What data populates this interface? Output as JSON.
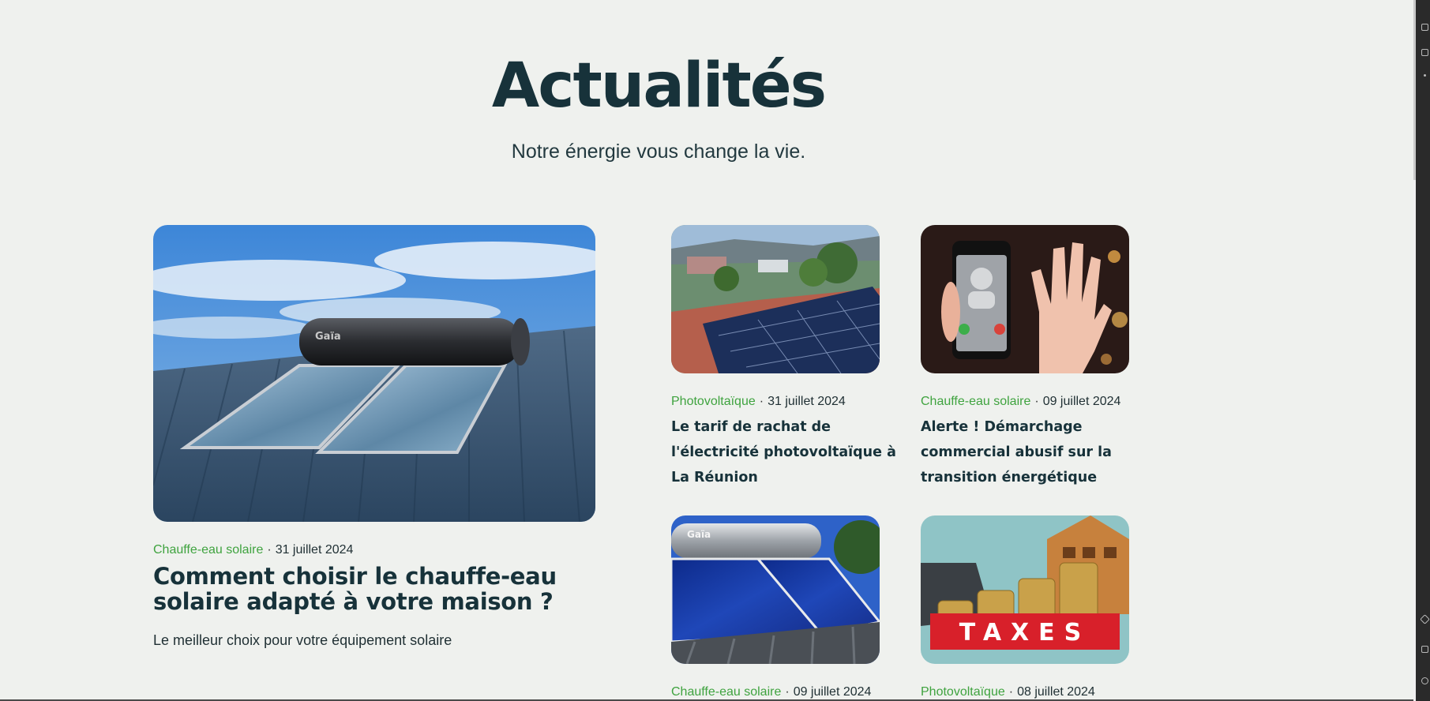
{
  "header": {
    "title": "Actualités",
    "subtitle": "Notre énergie vous change la vie."
  },
  "featured": {
    "category": "Chauffe-eau solaire",
    "date": "31 juillet 2024",
    "title": "Comment choisir le chauffe-eau solaire adapté à votre maison ?",
    "excerpt": "Le meilleur choix pour votre équipement solaire",
    "image_brand": "Gaïa"
  },
  "articles": [
    {
      "category": "Photovoltaïque",
      "date": "31 juillet 2024",
      "title": "Le tarif de rachat de l'électricité photovoltaïque à La Réunion"
    },
    {
      "category": "Chauffe-eau solaire",
      "date": "09 juillet 2024",
      "title": "Alerte ! Démarchage commercial abusif sur la transition énergétique"
    },
    {
      "category": "Chauffe-eau solaire",
      "date": "09 juillet 2024",
      "image_brand": "Gaïa"
    },
    {
      "category": "Photovoltaïque",
      "date": "08 juillet 2024",
      "image_text": "TAXES"
    }
  ],
  "colors": {
    "background": "#eff1ee",
    "heading": "#17323a",
    "category": "#3fa33f"
  }
}
